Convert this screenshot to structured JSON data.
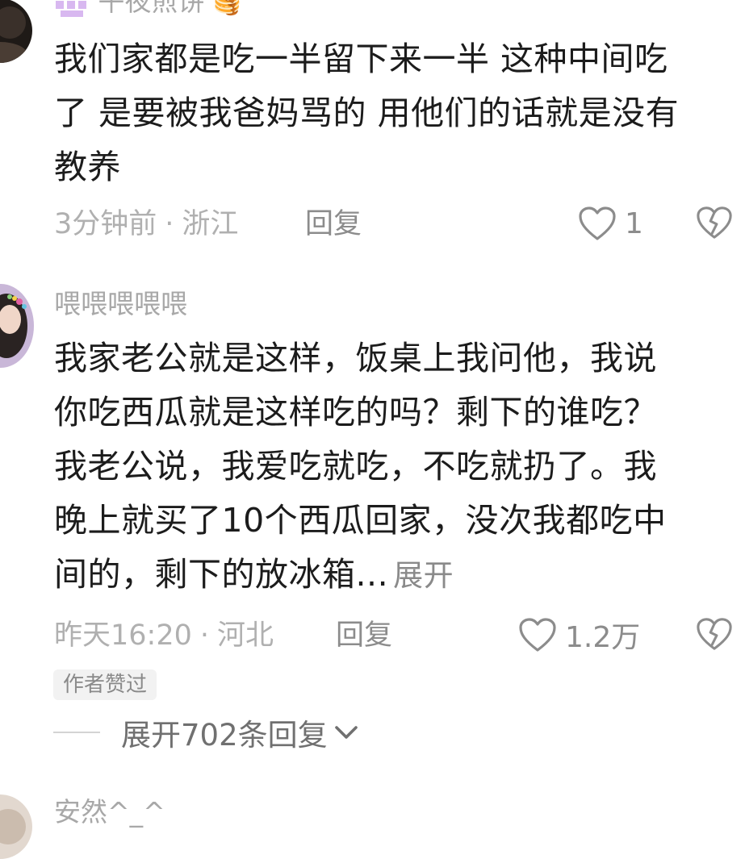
{
  "comments": [
    {
      "username": "午夜煎饼",
      "username_emoji": "🥞",
      "lines": [
        "我们家都是吃一半留下来一半 这种中间吃",
        "了 是要被我爸妈骂的 用他们的话就是没有",
        "教养"
      ],
      "time": "3分钟前",
      "separator": "·",
      "location": "浙江",
      "reply_label": "回复",
      "likes": "1"
    },
    {
      "username": "喂喂喂喂喂",
      "lines": [
        "我家老公就是这样，饭桌上我问他，我说",
        "你吃西瓜就是这样吃的吗？剩下的谁吃？",
        "我老公说，我爱吃就吃，不吃就扔了。我",
        "晚上就买了10个西瓜回家，没次我都吃中",
        "间的，剩下的放冰箱..."
      ],
      "expand_label": "展开",
      "time": "昨天16:20",
      "separator": "·",
      "location": "河北",
      "reply_label": "回复",
      "likes": "1.2万",
      "author_badge": "作者赞过",
      "expand_replies_label": "展开702条回复"
    },
    {
      "username": "安然^_^"
    }
  ]
}
